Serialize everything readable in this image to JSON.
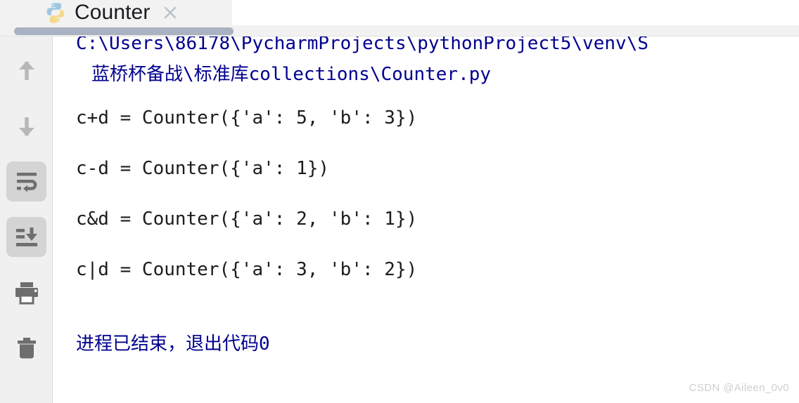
{
  "window": {
    "tab": {
      "icon": "python-file-icon",
      "title": "Counter",
      "close_label": "×"
    }
  },
  "toolbar": {
    "items": [
      {
        "name": "scroll-up-icon",
        "label": "Up",
        "active": false
      },
      {
        "name": "scroll-down-icon",
        "label": "Down",
        "active": false
      },
      {
        "name": "soft-wrap-icon",
        "label": "Soft-Wrap",
        "active": true
      },
      {
        "name": "scroll-to-end-icon",
        "label": "Scroll to End",
        "active": true
      },
      {
        "name": "print-icon",
        "label": "Print",
        "active": false
      },
      {
        "name": "trash-icon",
        "label": "Clear All",
        "active": false
      }
    ]
  },
  "console": {
    "path_line_1": "C:\\Users\\86178\\PycharmProjects\\pythonProject5\\venv\\S",
    "path_line_2": "蓝桥杯备战\\标准库collections\\Counter.py",
    "output": [
      "c+d = Counter({'a': 5, 'b': 3})",
      "c-d = Counter({'a': 1})",
      "c&d = Counter({'a': 2, 'b': 1})",
      "c|d = Counter({'a': 3, 'b': 2})"
    ],
    "exit_line": "进程已结束，退出代码0"
  },
  "watermark": {
    "text": "CSDN @Aileen_0v0"
  },
  "colors": {
    "link": "#00008f",
    "text": "#1c1c1c",
    "toolbar_bg": "#f0f0f0",
    "tab_bg": "#f2f2f2",
    "scrollbar_thumb": "#a9b2c0",
    "icon_grey": "#b8b8b8",
    "icon_dark": "#6e6e6e",
    "active_bg": "#d4d4d4",
    "watermark": "#cfcfcf"
  }
}
